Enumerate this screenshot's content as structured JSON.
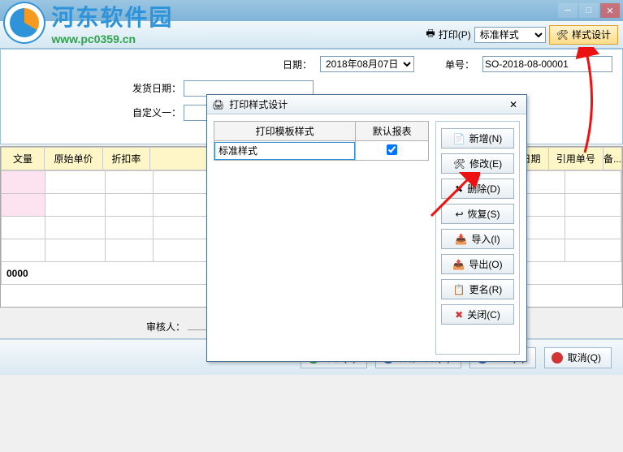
{
  "watermark": {
    "title": "河东软件园",
    "url": "www.pc0359.cn"
  },
  "toolbar": {
    "print_label": "打印(P)",
    "style_select_value": "标准样式",
    "style_design_label": "样式设计"
  },
  "form": {
    "date_label": "日期：",
    "date_value": "2018年08月07日",
    "no_label": "单号：",
    "no_value": "SO-2018-08-00001",
    "ship_date_label": "发货日期：",
    "custom1_label": "自定义一："
  },
  "grid": {
    "cols": [
      "文量",
      "原始单价",
      "折扣率",
      "发货日期",
      "引用单号",
      "备..."
    ],
    "sum_label": "0000"
  },
  "sign": {
    "reviewer_label": "审核人："
  },
  "footer": {
    "audit": "审核(E)",
    "save_new": "保存新增(S)",
    "ok": "确定(A)",
    "cancel": "取消(Q)"
  },
  "dialog": {
    "title": "打印样式设计",
    "col_template": "打印模板样式",
    "col_default": "默认报表",
    "row_value": "标准样式",
    "row_checked": true,
    "buttons": {
      "add": "新增(N)",
      "edit": "修改(E)",
      "delete": "删除(D)",
      "restore": "恢复(S)",
      "import": "导入(I)",
      "export": "导出(O)",
      "rename": "更名(R)",
      "close": "关闭(C)"
    }
  }
}
